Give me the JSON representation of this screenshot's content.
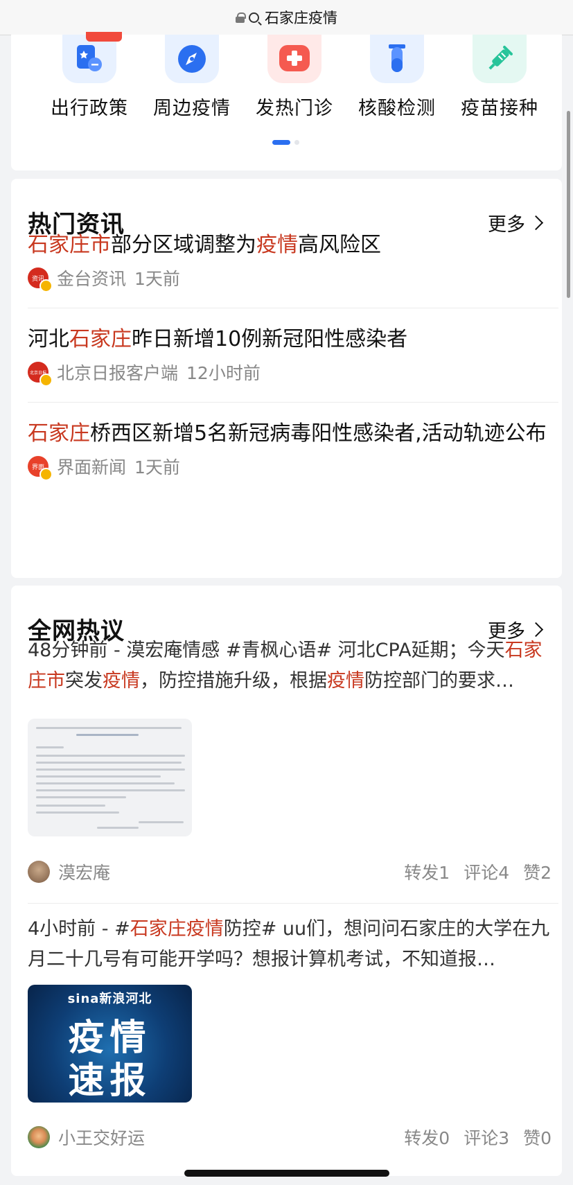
{
  "browser": {
    "url_text": "石家庄疫情"
  },
  "quick_links": [
    {
      "label": "出行政策",
      "icon": "travel-policy-icon",
      "color": "#e8f1ff"
    },
    {
      "label": "周边疫情",
      "icon": "compass-icon",
      "color": "#e8f1ff"
    },
    {
      "label": "发热门诊",
      "icon": "medical-cross-icon",
      "color": "#ffe9e8"
    },
    {
      "label": "核酸检测",
      "icon": "test-tube-icon",
      "color": "#e8f1ff"
    },
    {
      "label": "疫苗接种",
      "icon": "syringe-icon",
      "color": "#e4f8f2"
    }
  ],
  "news": {
    "title": "热门资讯",
    "more": "更多",
    "items": [
      {
        "title_hl1": "石家庄市",
        "title_1": "部分区域调整为",
        "title_hl2": "疫情",
        "title_2": "高风险区",
        "source": "金台资讯",
        "time": "1天前",
        "icon_text": "资讯"
      },
      {
        "title_1": "河北",
        "title_hl1": "石家庄",
        "title_2": "昨日新增10例新冠阳性感染者",
        "source": "北京日报客户端",
        "time": "12小时前",
        "icon_text": "北京日报"
      },
      {
        "title_hl1": "石家庄",
        "title_1": "桥西区新增5名新冠病毒阳性感染者,活动轨迹公布",
        "source": "界面新闻",
        "time": "1天前",
        "icon_text": "界面"
      }
    ]
  },
  "opinion": {
    "title": "全网热议",
    "more": "更多",
    "posts": [
      {
        "t1": "48分钟前 - 漠宏庵情感 #青枫心语# 河北CPA延期；今天",
        "h1": "石家庄市",
        "t2": "突发",
        "h2": "疫情",
        "t3": "，防控措施升级，根据",
        "h3": "疫情",
        "t4": "防控部门的要求…",
        "author": "漠宏庵",
        "forward": "转发1",
        "comment": "评论4",
        "like": "赞2"
      },
      {
        "t1": "4小时前 - #",
        "h1": "石家庄疫情",
        "t2": "防控# uu们，想问问石家庄的大学在九月二十几号有可能开学吗？想报计算机考试，不知道报…",
        "author": "小王交好运",
        "forward": "转发0",
        "comment": "评论3",
        "like": "赞0",
        "thumb_logo": "sina新浪河北",
        "thumb_l1": "疫情",
        "thumb_l2": "速报"
      }
    ]
  }
}
